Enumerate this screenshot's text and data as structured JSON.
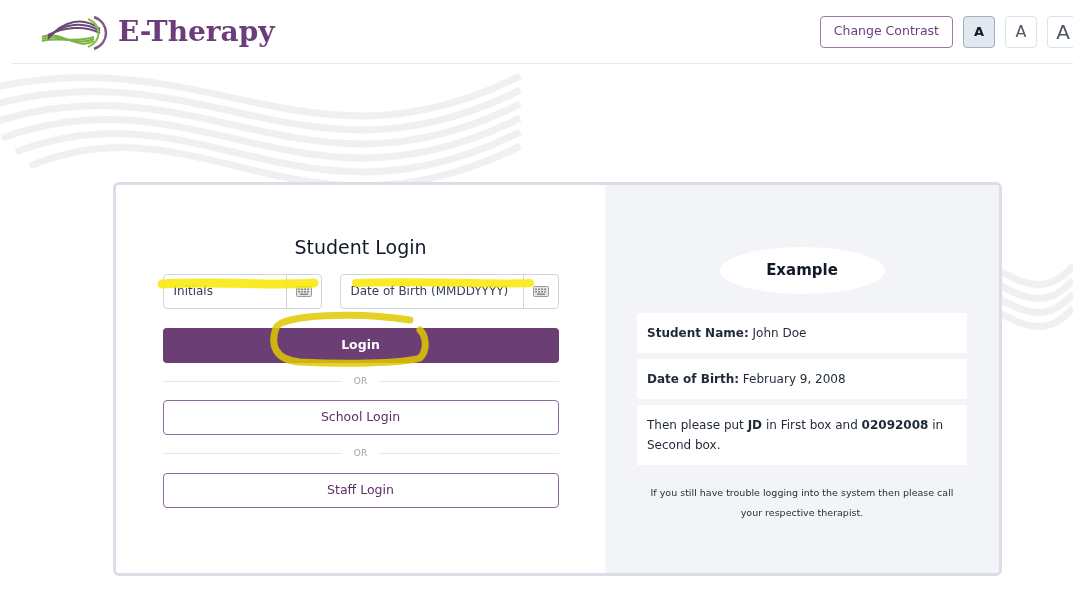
{
  "brand": {
    "name": "E-Therapy"
  },
  "header_controls": {
    "contrast_button": "Change Contrast",
    "font_sizes": [
      {
        "label": "A",
        "selected": true
      },
      {
        "label": "A",
        "selected": false
      },
      {
        "label": "A",
        "selected": false
      }
    ]
  },
  "login": {
    "title": "Student Login",
    "fields": [
      {
        "placeholder": "Initials"
      },
      {
        "placeholder": "Date of Birth (MMDDYYYY)"
      }
    ],
    "primary_button": "Login",
    "alternatives": [
      {
        "divider": "OR",
        "button": "School Login"
      },
      {
        "divider": "OR",
        "button": "Staff Login"
      }
    ]
  },
  "example": {
    "title": "Example",
    "rows": [
      {
        "text": "**Student Name:** John Doe"
      },
      {
        "text": "**Date of Birth:** February 9, 2008"
      },
      {
        "text": "Then please put **JD** in First box and **02092008** in Second box."
      }
    ],
    "note": "If you still have trouble logging into the system then please call your respective therapist."
  }
}
